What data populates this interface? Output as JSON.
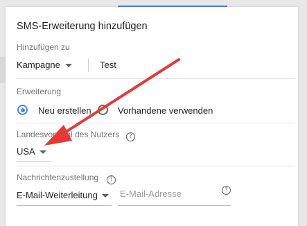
{
  "dialog": {
    "title": "SMS-Erweiterung hinzufügen"
  },
  "add_to": {
    "label": "Hinzufügen zu",
    "level_value": "Kampagne",
    "campaign_value": "Test"
  },
  "extension": {
    "label": "Erweiterung",
    "options": [
      {
        "label": "Neu erstellen",
        "selected": true
      },
      {
        "label": "Vorhandene verwenden",
        "selected": false
      }
    ]
  },
  "country": {
    "label": "Landesvorwahl des Nutzers",
    "value": "USA",
    "help_icon": "help-circle-icon"
  },
  "message_delivery": {
    "label": "Nachrichtenzustellung",
    "method_value": "E-Mail-Weiterleitung",
    "email_placeholder": "E-Mail-Adresse",
    "help_icon": "help-circle-icon"
  },
  "annotation": {
    "icon": "red-arrow",
    "color": "#e53935"
  },
  "colors": {
    "accent": "#4285f4",
    "annotation": "#e53935"
  }
}
